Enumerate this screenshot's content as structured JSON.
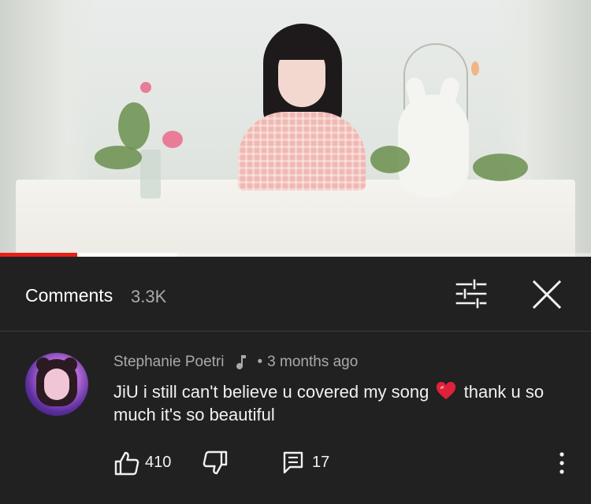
{
  "comments_header": {
    "title": "Comments",
    "count": "3.3K"
  },
  "video": {
    "progress_fraction": 0.13,
    "buffered_fraction": 0.3
  },
  "comment": {
    "author": "Stephanie Poetri",
    "separator": "•",
    "time": "3 months ago",
    "text_part1": "JiU i still can't believe u covered my song",
    "text_part2": " thank u so much it's so beautiful",
    "likes": "410",
    "replies": "17"
  },
  "icons": {
    "filter": "tune-icon",
    "close": "close-icon",
    "music": "music-note-icon",
    "heart": "red-heart-icon",
    "like": "thumb-up-icon",
    "dislike": "thumb-down-icon",
    "reply": "comment-reply-icon",
    "more": "more-vert-icon"
  },
  "colors": {
    "background": "#212121",
    "progress": "#e62117",
    "secondary_text": "#aaaaaa",
    "heart": "#e0213a"
  }
}
